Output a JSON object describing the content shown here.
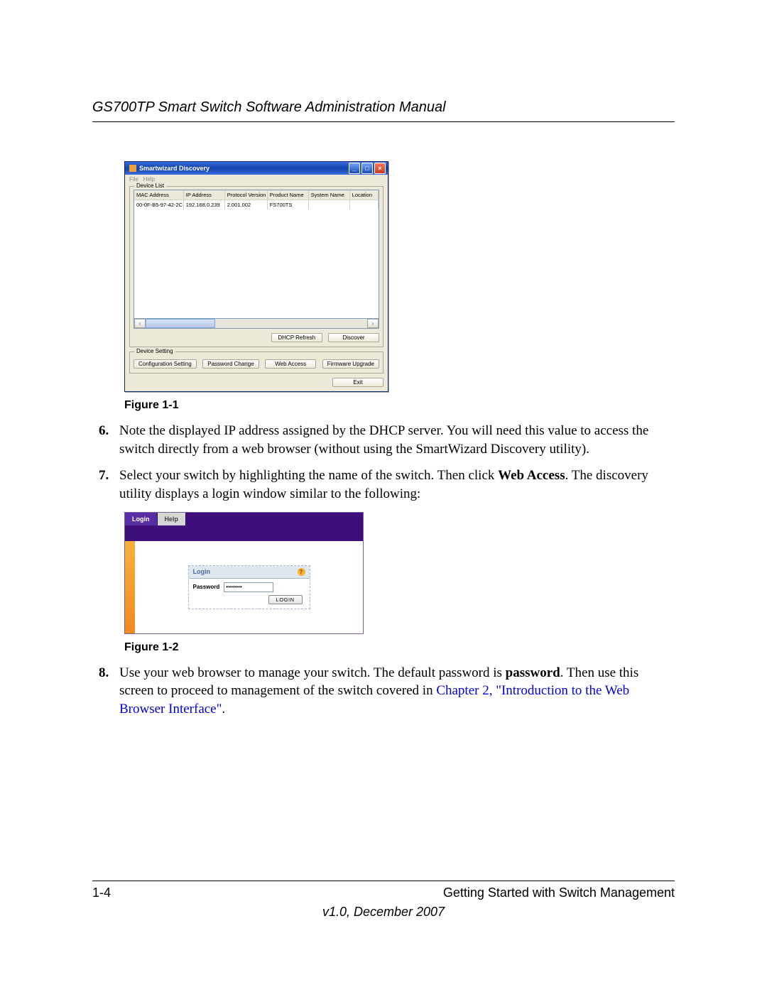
{
  "header": {
    "title": "GS700TP Smart Switch Software Administration Manual"
  },
  "discovery": {
    "window_title": "Smartwizard Discovery",
    "menu": {
      "file": "File",
      "help": "Help"
    },
    "device_list_legend": "Device List",
    "columns": [
      "MAC Address",
      "IP Address",
      "Protocol Version",
      "Product Name",
      "System Name",
      "Location"
    ],
    "row": {
      "mac": "00-0F-B5-97-42-2C",
      "ip": "192.168.0.239",
      "protocol": "2.001.002",
      "product": "FS700TS",
      "system": "",
      "location": ""
    },
    "buttons": {
      "dhcp_refresh": "DHCP Refresh",
      "discover": "Discover"
    },
    "device_setting_legend": "Device Setting",
    "device_setting_buttons": {
      "config": "Configuration Setting",
      "password": "Password Change",
      "web_access": "Web Access",
      "firmware": "Firmware Upgrade"
    },
    "exit": "Exit"
  },
  "figure1_caption": "Figure 1-1",
  "steps": {
    "s6a": "Note the displayed IP address assigned by the DHCP server. You will need this value to access the switch directly from a web browser (without using the SmartWizard Discovery utility).",
    "s7a": "Select your switch by highlighting the name of the switch. Then click ",
    "s7bold": "Web Access",
    "s7b": ". The discovery utility displays a login window similar to the following:",
    "s8a": "Use your web browser to manage your switch. The default password is ",
    "s8bold": "password",
    "s8b": ". Then use this screen to proceed to management of the switch covered in ",
    "s8link": "Chapter 2, \"Introduction to the Web Browser Interface\"",
    "s8c": "."
  },
  "login": {
    "tab_login": "Login",
    "tab_help": "Help",
    "panel_title": "Login",
    "password_label": "Password",
    "password_value": "••••••••",
    "login_button": "LOGIN"
  },
  "figure2_caption": "Figure 1-2",
  "footer": {
    "page": "1-4",
    "section": "Getting Started with Switch Management",
    "version": "v1.0, December 2007"
  }
}
